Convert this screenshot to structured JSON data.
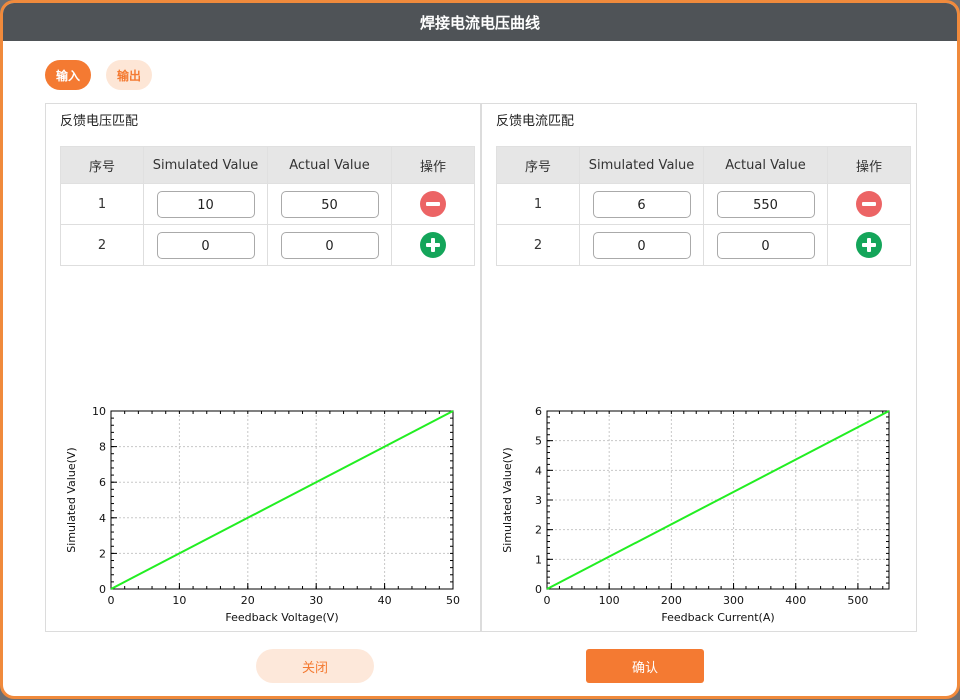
{
  "dialog": {
    "title": "焊接电流电压曲线",
    "tabs": {
      "input": "输入",
      "output": "输出"
    },
    "buttons": {
      "close": "关闭",
      "confirm": "确认"
    }
  },
  "voltage_panel": {
    "title": "反馈电压匹配",
    "headers": [
      "序号",
      "Simulated Value",
      "Actual Value",
      "操作"
    ],
    "rows": [
      {
        "index": "1",
        "simulated": "10",
        "actual": "50",
        "action": "remove"
      },
      {
        "index": "2",
        "simulated": "0",
        "actual": "0",
        "action": "add"
      }
    ]
  },
  "current_panel": {
    "title": "反馈电流匹配",
    "headers": [
      "序号",
      "Simulated Value",
      "Actual Value",
      "操作"
    ],
    "rows": [
      {
        "index": "1",
        "simulated": "6",
        "actual": "550",
        "action": "remove"
      },
      {
        "index": "2",
        "simulated": "0",
        "actual": "0",
        "action": "add"
      }
    ]
  },
  "icons": {
    "remove": "minus-circle-icon",
    "add": "plus-circle-icon"
  },
  "colors": {
    "accent": "#f47a32",
    "titlebar": "#4f5357",
    "line": "#22ee22",
    "remove": "#ec6465",
    "add": "#14a55a"
  },
  "chart_data": [
    {
      "type": "line",
      "xlabel": "Feedback Voltage(V)",
      "ylabel": "Simulated Value(V)",
      "xlim": [
        0,
        50
      ],
      "ylim": [
        0,
        10
      ],
      "xticks": [
        0,
        10,
        20,
        30,
        40,
        50
      ],
      "yticks": [
        0,
        2,
        4,
        6,
        8,
        10
      ],
      "grid": true,
      "series": [
        {
          "x": [
            0,
            50
          ],
          "y": [
            0,
            10
          ],
          "color": "#22ee22"
        }
      ]
    },
    {
      "type": "line",
      "xlabel": "Feedback Current(A)",
      "ylabel": "Simulated Value(V)",
      "xlim": [
        0,
        550
      ],
      "ylim": [
        0,
        6
      ],
      "xticks": [
        0,
        100,
        200,
        300,
        400,
        500
      ],
      "yticks": [
        0,
        1,
        2,
        3,
        4,
        5,
        6
      ],
      "grid": true,
      "series": [
        {
          "x": [
            0,
            550
          ],
          "y": [
            0,
            6
          ],
          "color": "#22ee22"
        }
      ]
    }
  ]
}
